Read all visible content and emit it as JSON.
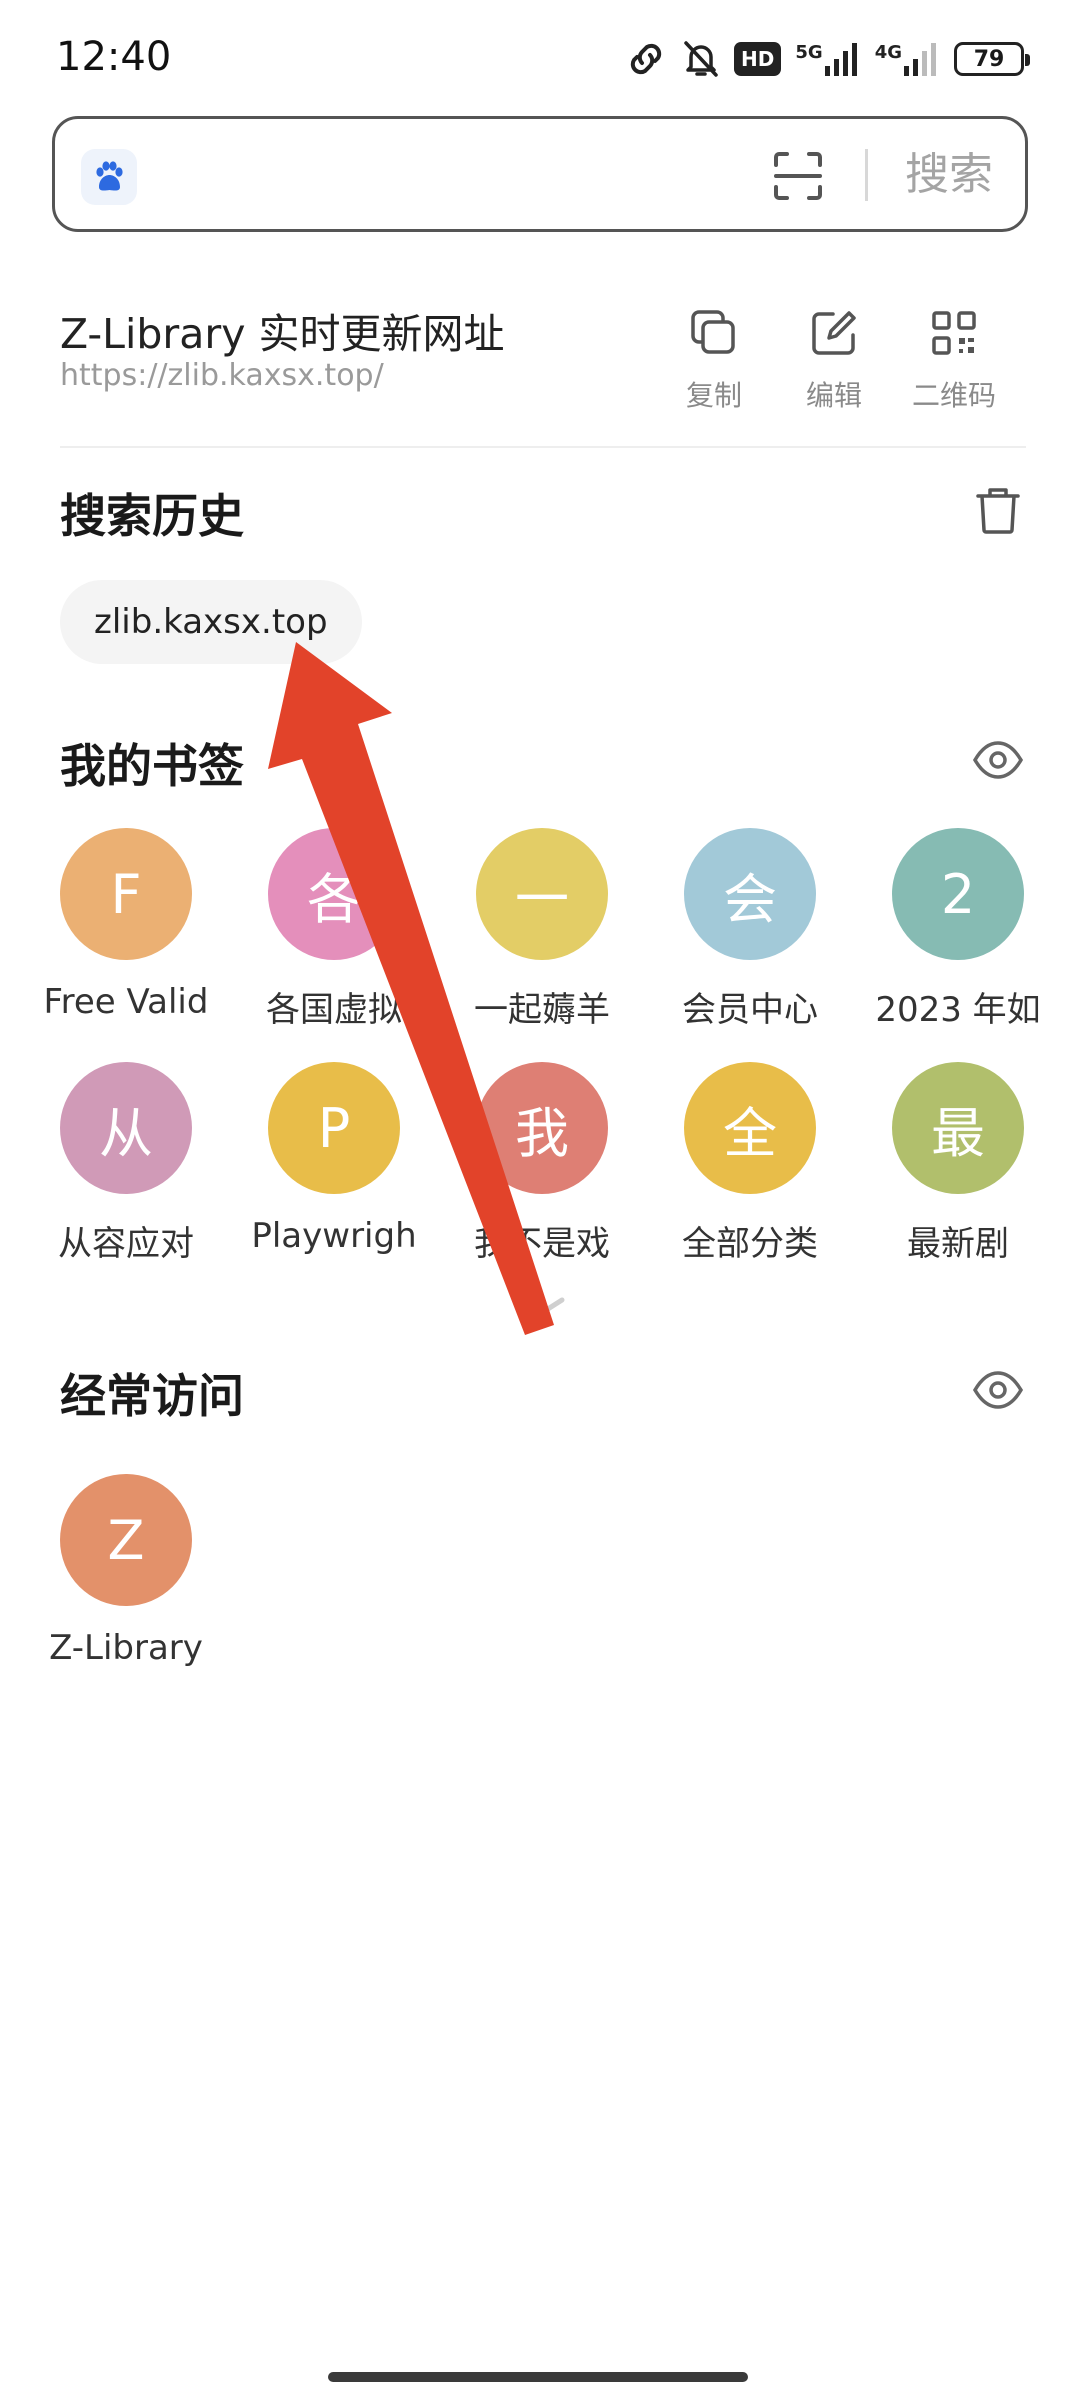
{
  "status_bar": {
    "time": "12:40",
    "hd_label": "HD",
    "net1": "5G",
    "net2": "4G",
    "battery": "79"
  },
  "search": {
    "placeholder": "",
    "button_label": "搜索"
  },
  "current_page": {
    "title": "Z-Library 实时更新网址",
    "url": "https://zlib.kaxsx.top/",
    "actions": [
      {
        "label": "复制",
        "icon": "copy-icon"
      },
      {
        "label": "编辑",
        "icon": "edit-icon"
      },
      {
        "label": "二维码",
        "icon": "qrcode-icon"
      }
    ]
  },
  "history": {
    "title": "搜索历史",
    "items": [
      "zlib.kaxsx.top"
    ]
  },
  "bookmarks": {
    "title": "我的书签",
    "items": [
      {
        "initial": "F",
        "label": "Free Valid",
        "color": "#ebb073"
      },
      {
        "initial": "各",
        "label": "各国虚拟",
        "color": "#e48fbb"
      },
      {
        "initial": "一",
        "label": "一起薅羊",
        "color": "#e3cd66"
      },
      {
        "initial": "会",
        "label": "会员中心",
        "color": "#a2c9d8"
      },
      {
        "initial": "2",
        "label": "2023 年如",
        "color": "#86bbb3"
      },
      {
        "initial": "从",
        "label": "从容应对",
        "color": "#d09ab7"
      },
      {
        "initial": "P",
        "label": "Playwrigh",
        "color": "#e8bd49"
      },
      {
        "initial": "我",
        "label": "我不是戏",
        "color": "#de7f74"
      },
      {
        "initial": "全",
        "label": "全部分类",
        "color": "#e8bd49"
      },
      {
        "initial": "最",
        "label": "最新剧",
        "color": "#b1bf6c"
      }
    ]
  },
  "frequent": {
    "title": "经常访问",
    "items": [
      {
        "initial": "Z",
        "label": "Z-Library",
        "color": "#e3916a"
      }
    ]
  },
  "colors": {
    "arrow": "#e2432a"
  }
}
